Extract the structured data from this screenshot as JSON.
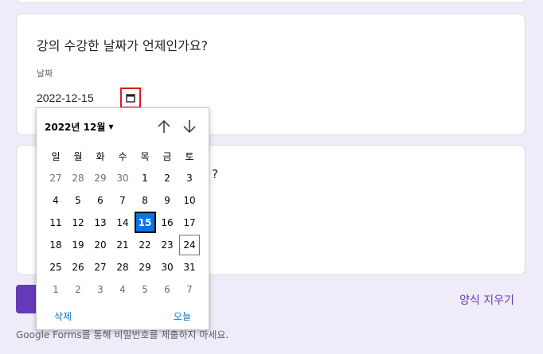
{
  "question1": {
    "title": "강의 수강한 날짜가 언제인가요?",
    "field_label": "날짜",
    "date_value": "2022-12-15"
  },
  "question2": {
    "title_fragment": "?"
  },
  "footer": {
    "clear_form_label": "양식 지우기",
    "notice": "Google Forms를 통해 비밀번호를 제출하지 마세요."
  },
  "date_picker": {
    "month_label": "2022년 12월",
    "weekdays": [
      "일",
      "월",
      "화",
      "수",
      "목",
      "금",
      "토"
    ],
    "weeks": [
      [
        "27",
        "28",
        "29",
        "30",
        "1",
        "2",
        "3"
      ],
      [
        "4",
        "5",
        "6",
        "7",
        "8",
        "9",
        "10"
      ],
      [
        "11",
        "12",
        "13",
        "14",
        "15",
        "16",
        "17"
      ],
      [
        "18",
        "19",
        "20",
        "21",
        "22",
        "23",
        "24"
      ],
      [
        "25",
        "26",
        "27",
        "28",
        "29",
        "30",
        "31"
      ],
      [
        "1",
        "2",
        "3",
        "4",
        "5",
        "6",
        "7"
      ]
    ],
    "selected_day": "15",
    "today_day": "24",
    "delete_label": "삭제",
    "today_label": "오늘"
  },
  "colors": {
    "background": "#efebf8",
    "accent": "#673ab7",
    "selected_day": "#0a74e6",
    "link": "#0a74c4",
    "highlight_box": "#e0191a"
  },
  "icons": {
    "calendar": "calendar-icon",
    "prev_month": "arrow-up-icon",
    "next_month": "arrow-down-icon",
    "month_dropdown": "caret-down-icon"
  }
}
